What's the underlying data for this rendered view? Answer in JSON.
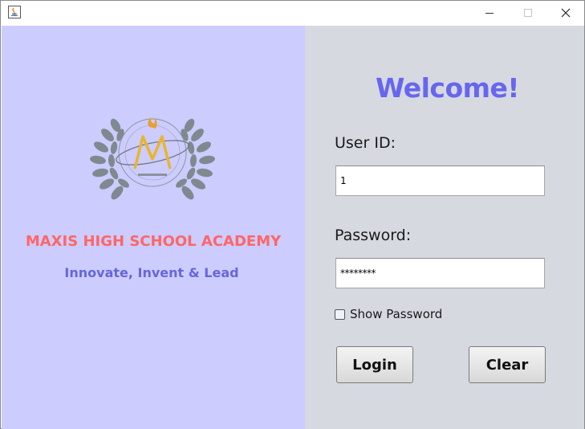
{
  "window": {
    "controls": {
      "minimize_icon": "minimize-icon",
      "maximize_icon": "maximize-icon",
      "close_icon": "close-icon"
    }
  },
  "left": {
    "school_name": "MAXIS HIGH SCHOOL ACADEMY",
    "motto": "Innovate, Invent & Lead",
    "colors": {
      "background": "#ccccff",
      "school_name": "#ff6666",
      "motto": "#6666dd"
    }
  },
  "right": {
    "welcome": "Welcome!",
    "user_id_label": "User ID:",
    "user_id_value": "1",
    "password_label": "Password:",
    "password_value": "********",
    "show_password_label": "Show Password",
    "show_password_checked": false,
    "login_label": "Login",
    "clear_label": "Clear",
    "colors": {
      "background": "#d6d9e0",
      "welcome": "#6666ee"
    }
  }
}
